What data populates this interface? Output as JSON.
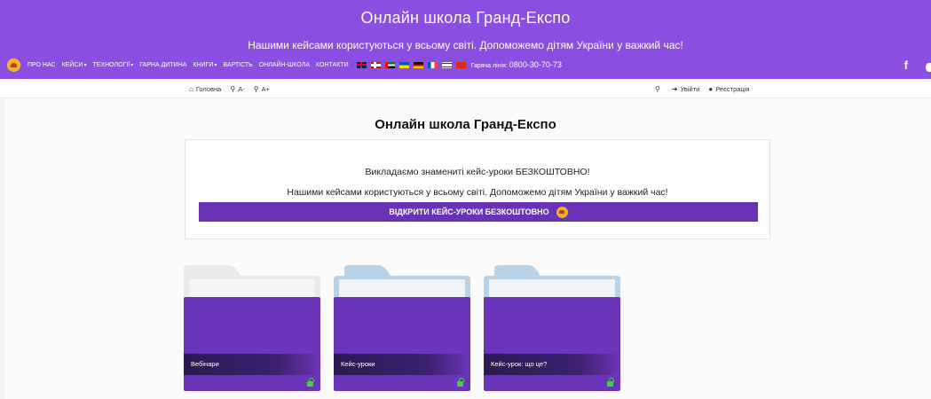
{
  "header": {
    "title": "Онлайн школа Гранд-Експо",
    "tagline": "Нашими кейсами користуються у всьому світі. Допоможемо дітям України у важкий час!",
    "menu": [
      {
        "label": "Про нас",
        "has_dropdown": false
      },
      {
        "label": "Кейси",
        "has_dropdown": true
      },
      {
        "label": "Технології",
        "has_dropdown": true
      },
      {
        "label": "Гарна дитина",
        "has_dropdown": false
      },
      {
        "label": "Книги",
        "has_dropdown": true
      },
      {
        "label": "Вартість",
        "has_dropdown": false
      },
      {
        "label": "Онлайн-школа",
        "has_dropdown": false
      },
      {
        "label": "Контакти",
        "has_dropdown": false
      }
    ],
    "caret": "▾",
    "hotline_label": "Гаряча лінія:",
    "hotline_number": "0800-30-70-73",
    "facebook": "f",
    "colors": {
      "header_bg": "#8a4fe0",
      "accent": "#6a33b5"
    }
  },
  "subnav": {
    "home": "Головна",
    "font_decrease": "A-",
    "font_increase": "A+",
    "login": "Увійти",
    "register": "Реєстрація"
  },
  "main": {
    "page_title": "Онлайн школа Гранд-Експо",
    "card_line1": "Викладаємо знамениті кейс-уроки БЕЗКОШТОВНО!",
    "card_line2": "Нашими кейсами користуються у всьому світі. Допоможемо дітям України у важкий час!",
    "cta": "ВІДКРИТИ КЕЙС-УРОКИ БЕЗКОШТОВНО"
  },
  "folders": [
    {
      "label": "Вебінари"
    },
    {
      "label": "Кейс-уроки"
    },
    {
      "label": "Кейс-урок: що це?"
    }
  ]
}
